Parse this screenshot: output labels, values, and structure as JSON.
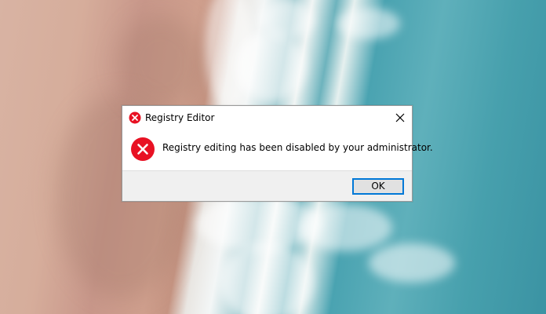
{
  "dialog": {
    "title": "Registry Editor",
    "message": "Registry editing has been disabled by your administrator.",
    "ok_label": "OK",
    "title_icon": "error-icon",
    "message_icon": "error-icon",
    "close_icon": "close-icon"
  },
  "colors": {
    "error_red": "#e81123",
    "focus_blue": "#0078d7",
    "footer_bg": "#f0f0f0"
  }
}
